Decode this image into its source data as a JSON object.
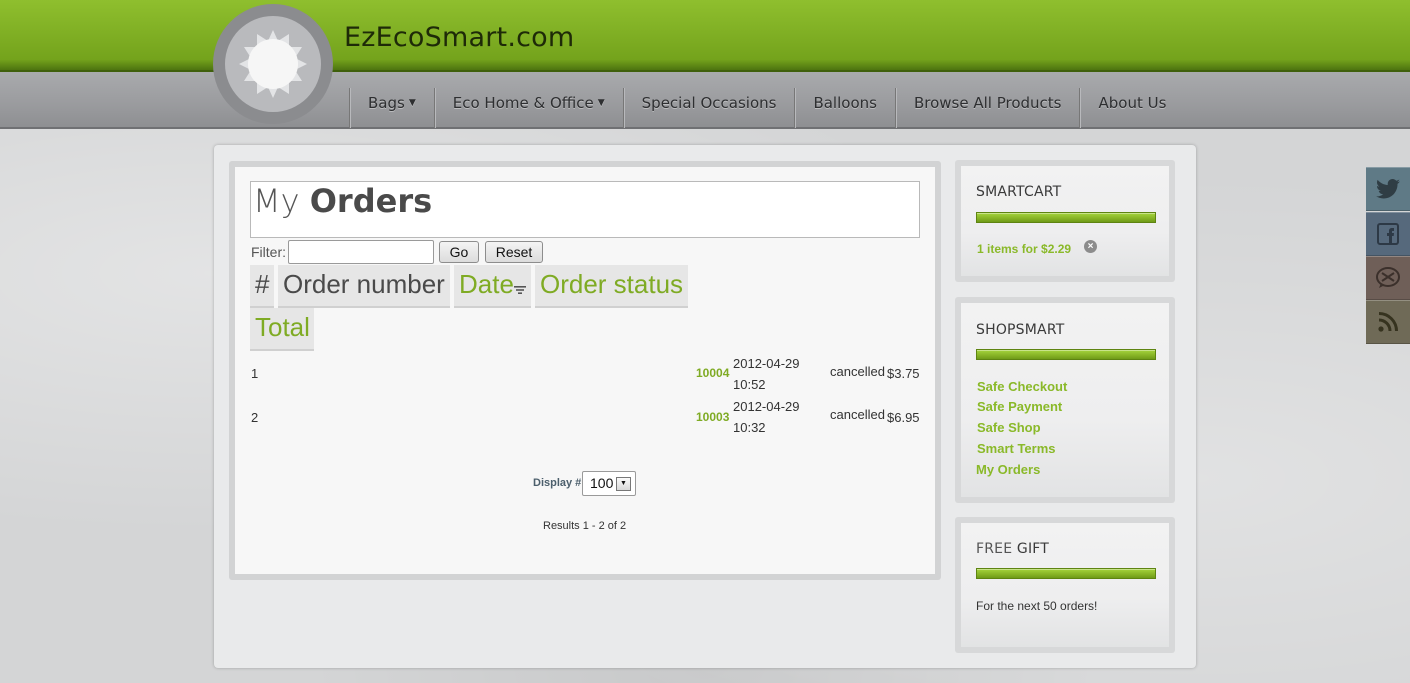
{
  "site": {
    "title": "EzEcoSmart.com"
  },
  "nav": {
    "items": [
      {
        "label": "Bags",
        "has_dropdown": true
      },
      {
        "label": "Eco Home & Office",
        "has_dropdown": true
      },
      {
        "label": "Special Occasions",
        "has_dropdown": false
      },
      {
        "label": "Balloons",
        "has_dropdown": false
      },
      {
        "label": "Browse All Products",
        "has_dropdown": false
      },
      {
        "label": "About Us",
        "has_dropdown": false
      }
    ],
    "caret": "▼"
  },
  "page": {
    "title_light": "My ",
    "title_bold": "Orders"
  },
  "filter": {
    "label": "Filter:",
    "value": "",
    "go_label": "Go",
    "reset_label": "Reset"
  },
  "table": {
    "headers": [
      "#",
      "Order number",
      "Date",
      "Order status",
      "Total"
    ],
    "rows": [
      {
        "index": "1",
        "order_number": "10004",
        "date": "2012-04-29",
        "time": "10:52",
        "status": "cancelled",
        "total": "$3.75"
      },
      {
        "index": "2",
        "order_number": "10003",
        "date": "2012-04-29",
        "time": "10:32",
        "status": "cancelled",
        "total": "$6.95"
      }
    ]
  },
  "pagination": {
    "display_label": "Display #",
    "display_value": "100",
    "results": "Results 1 - 2 of 2"
  },
  "sidebar": {
    "smartcart": {
      "title": "SMARTCART",
      "summary": "1 items for $2.29",
      "remove_glyph": "×"
    },
    "shopsmart": {
      "title": "SHOPSMART",
      "links": [
        "Safe Checkout",
        "Safe Payment",
        "Safe Shop",
        "Smart Terms",
        "My Orders"
      ]
    },
    "free_gift": {
      "title_light": "FREE ",
      "title_bold": "GIFT",
      "text": "For the next 50 orders!"
    }
  },
  "social": [
    {
      "icon": "twitter-icon",
      "color": "#5f7a86"
    },
    {
      "icon": "facebook-icon",
      "color": "#56697c"
    },
    {
      "icon": "email-icon",
      "color": "#6f5f58"
    },
    {
      "icon": "rss-icon",
      "color": "#6f6a57"
    }
  ],
  "colors": {
    "brand_green": "#7fab24",
    "link_green": "#8ab929"
  }
}
